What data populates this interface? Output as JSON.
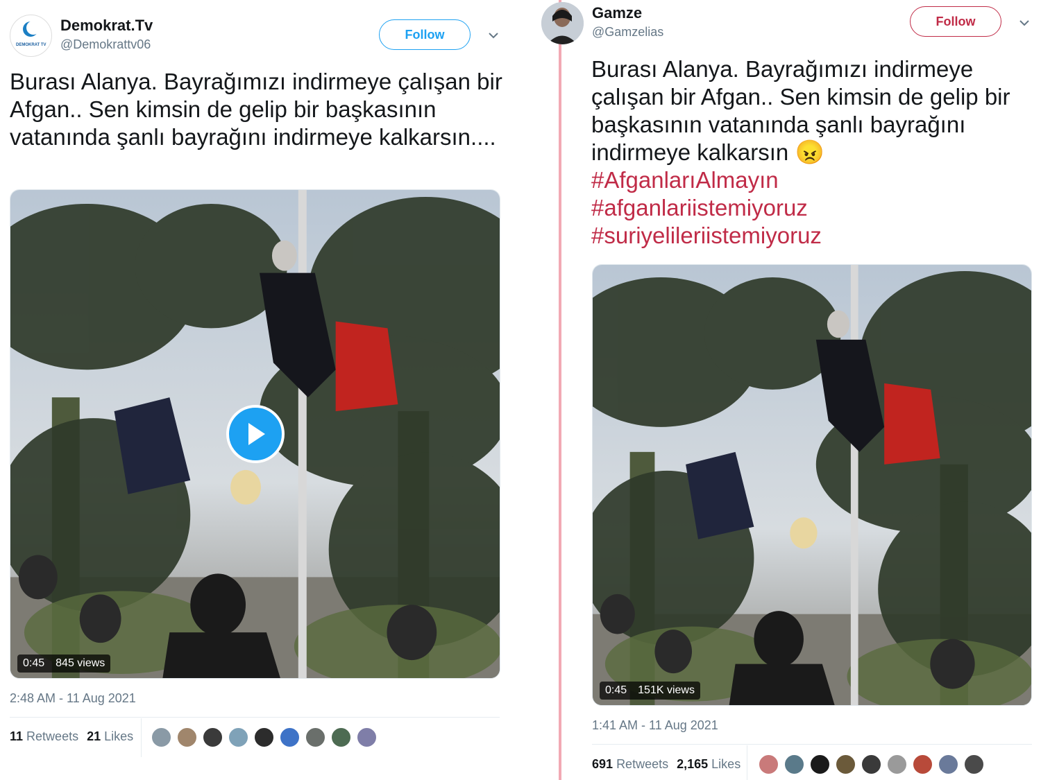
{
  "left": {
    "name": "Demokrat.Tv",
    "handle": "@Demokrattv06",
    "avatar_label": "DEMOKRAT TV",
    "follow_label": "Follow",
    "text": "Burası Alanya. Bayrağımızı indirmeye çalışan bir Afgan.. Sen kimsin de gelip bir başkasının vatanında şanlı bayrağını indirmeye kalkarsın....",
    "duration": "0:45",
    "views": "845 views",
    "timestamp": "2:48 AM - 11 Aug 2021",
    "retweets_count": "11",
    "retweets_label": "Retweets",
    "likes_count": "21",
    "likes_label": "Likes",
    "likers": [
      "#8a9aa6",
      "#a0866c",
      "#3a3a3a",
      "#7fa2b8",
      "#2c2c2c",
      "#3e73c7",
      "#6a6f6b",
      "#4d6b52",
      "#7f7ea8"
    ],
    "colors": {
      "follow": "#1da1f2",
      "border": "#1da1f2"
    }
  },
  "right": {
    "name": "Gamze",
    "handle": "@Gamzelias",
    "follow_label": "Follow",
    "text": "Burası Alanya. Bayrağımızı indirmeye çalışan bir Afgan.. Sen kimsin de gelip bir başkasının vatanında şanlı bayrağını indirmeye kalkarsın",
    "emoji": "😠",
    "hashtags": [
      "#AfganlarıAlmayın",
      "#afganlariistemiyoruz",
      "#suriyelileriistemiyoruz"
    ],
    "duration": "0:45",
    "views": "151K views",
    "timestamp": "1:41 AM - 11 Aug 2021",
    "retweets_count": "691",
    "retweets_label": "Retweets",
    "likes_count": "2,165",
    "likes_label": "Likes",
    "likers": [
      "#c97a7a",
      "#5a7a8a",
      "#1a1a1a",
      "#6b5a3a",
      "#3a3a3a",
      "#9a9a9a",
      "#b84a3a",
      "#6a7a9a",
      "#4a4a4a"
    ],
    "colors": {
      "follow": "#c02b47",
      "border": "#c02b47"
    }
  }
}
